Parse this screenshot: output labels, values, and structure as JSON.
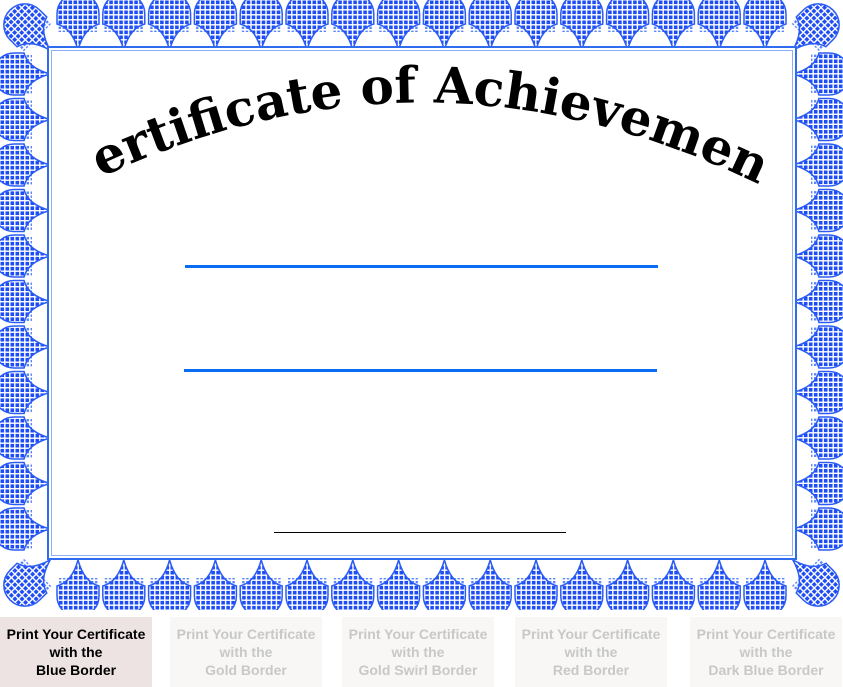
{
  "certificate": {
    "title": "Certificate of Achievement",
    "border_color": "#1e5cf5",
    "line_color": "#0a6cf0"
  },
  "buttons": [
    {
      "line1": "Print Your Certificate",
      "line2": "with the",
      "line3": "Blue Border",
      "active": true
    },
    {
      "line1": "Print Your Certificate",
      "line2": "with the",
      "line3": "Gold Border",
      "active": false
    },
    {
      "line1": "Print Your Certificate",
      "line2": "with the",
      "line3": "Gold Swirl Border",
      "active": false
    },
    {
      "line1": "Print Your Certificate",
      "line2": "with the",
      "line3": "Red Border",
      "active": false
    },
    {
      "line1": "Print Your Certificate",
      "line2": "with the",
      "line3": "Dark Blue Border",
      "active": false
    }
  ]
}
